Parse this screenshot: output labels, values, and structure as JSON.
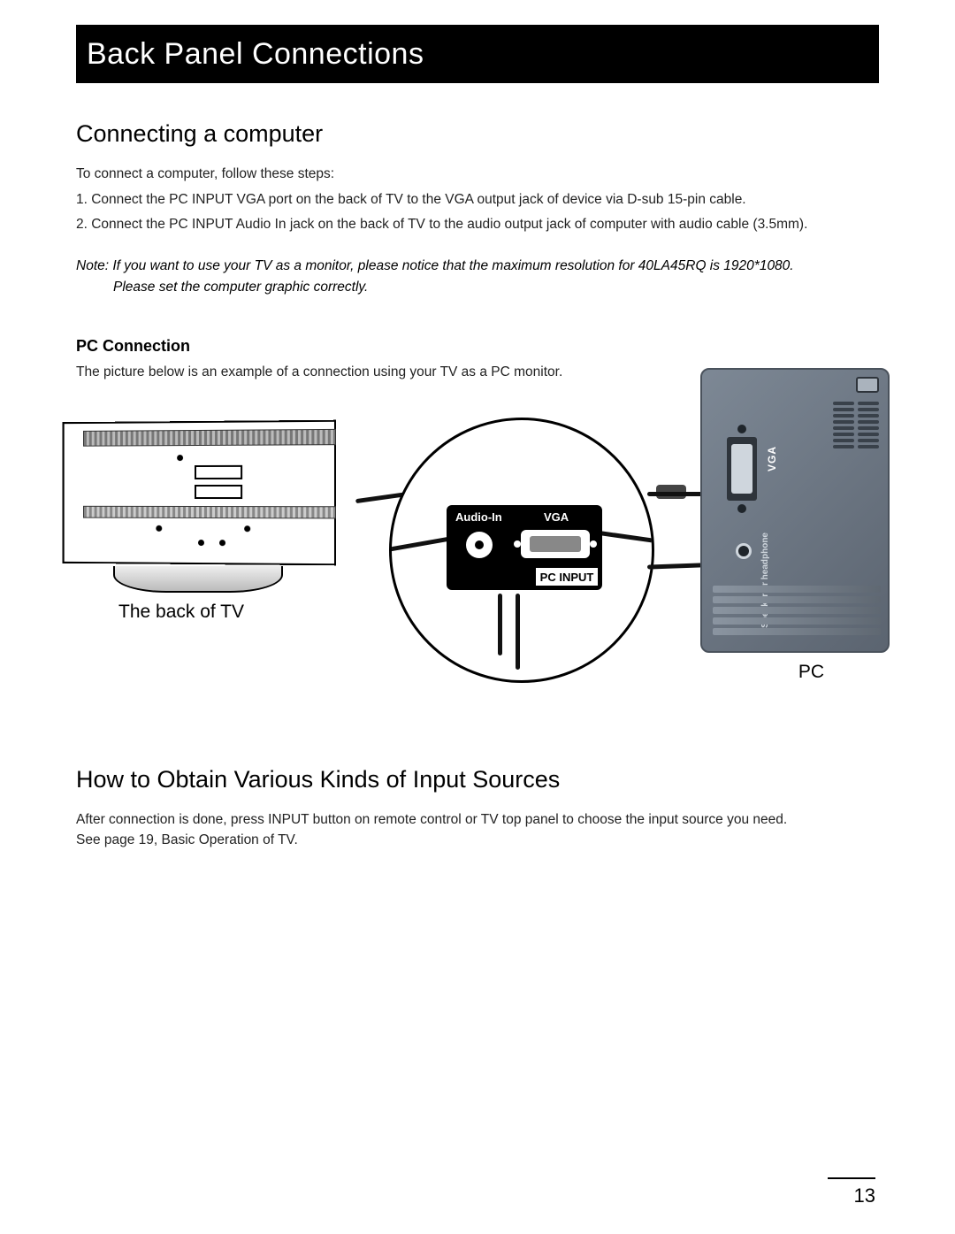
{
  "banner": {
    "title": "Back Panel Connections"
  },
  "section1": {
    "heading": "Connecting a computer",
    "intro": "To  connect a computer, follow these steps:",
    "step1": "1. Connect the PC INPUT VGA port on the back of TV to the VGA output jack of device via D-sub 15-pin cable.",
    "step2": "2. Connect the PC INPUT Audio In jack on the back of TV to the audio output jack of computer with audio cable (3.5mm).",
    "note_line1": "Note: If you want to use your TV as a monitor, please notice that the maximum resolution for 40LA45RQ is 1920*1080.",
    "note_line2": "Please set the computer graphic correctly."
  },
  "pc_connection": {
    "heading": "PC Connection",
    "intro": "The picture below is an example of a connection using your TV as a PC monitor.",
    "tv_label": "The back of TV",
    "pc_label": "PC",
    "zoom": {
      "audio_in": "Audio-In",
      "vga": "VGA",
      "pc_input": "PC INPUT"
    },
    "tower": {
      "vga_label": "VGA",
      "speaker_label": "Speaker or\nheadphone"
    }
  },
  "section2": {
    "heading": "How to Obtain Various Kinds of Input Sources",
    "body_line1": "After connection is done, press INPUT button on remote control or TV top panel to choose the input source you need.",
    "body_line2": "See page 19, Basic Operation of TV."
  },
  "page_number": "13"
}
